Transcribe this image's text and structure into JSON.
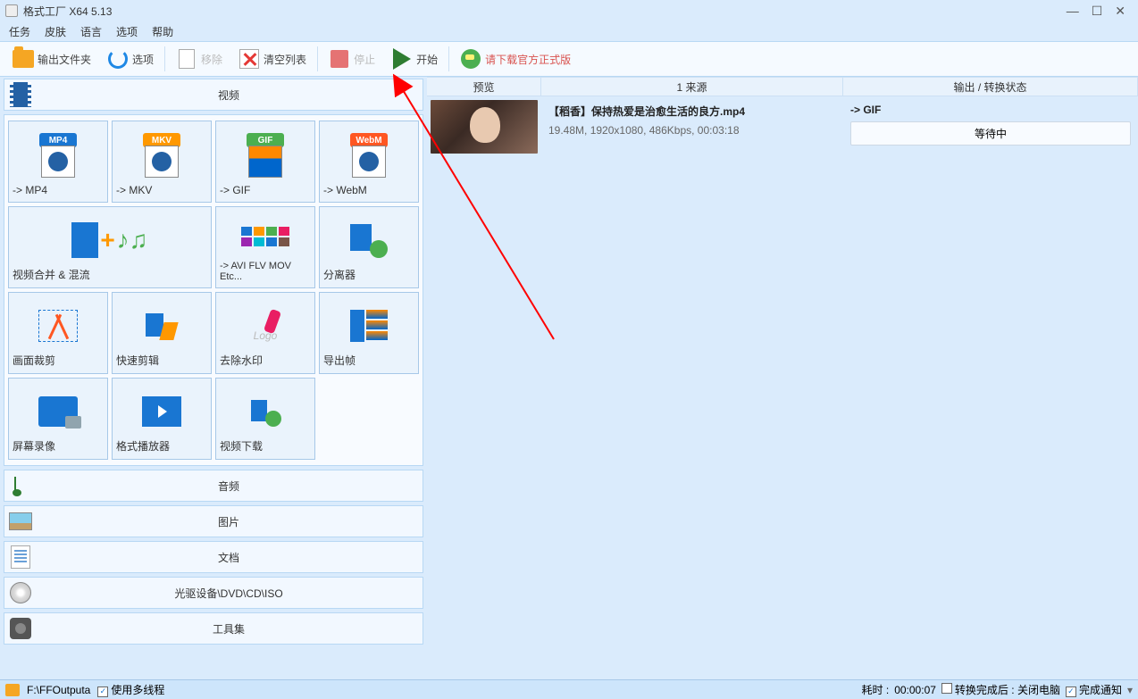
{
  "titlebar": {
    "title": "格式工厂 X64 5.13"
  },
  "menu": {
    "task": "任务",
    "skin": "皮肤",
    "language": "语言",
    "options": "选项",
    "help": "帮助"
  },
  "toolbar": {
    "output_folder": "输出文件夹",
    "options": "选项",
    "remove": "移除",
    "clear_list": "清空列表",
    "stop": "停止",
    "start": "开始",
    "download_official": "请下载官方正式版"
  },
  "categories": {
    "video": "视频",
    "audio": "音频",
    "image": "图片",
    "document": "文档",
    "disc": "光驱设备\\DVD\\CD\\ISO",
    "toolkit": "工具集"
  },
  "video_formats": {
    "mp4": {
      "badge": "MP4",
      "label": "-> MP4",
      "color": "#1976d2"
    },
    "mkv": {
      "badge": "MKV",
      "label": "-> MKV",
      "color": "#ff9800"
    },
    "gif": {
      "badge": "GIF",
      "label": "-> GIF",
      "color": "#4caf50"
    },
    "webm": {
      "badge": "WebM",
      "label": "-> WebM",
      "color": "#ff5722"
    },
    "merge": {
      "label": "视频合并 & 混流"
    },
    "avi_etc": {
      "label": "-> AVI FLV MOV Etc..."
    },
    "splitter": {
      "label": "分离器"
    },
    "crop": {
      "label": "画面裁剪"
    },
    "quick_edit": {
      "label": "快速剪辑"
    },
    "remove_logo": {
      "label": "去除水印",
      "logo_text": "Logo"
    },
    "export_frame": {
      "label": "导出帧"
    },
    "screen_rec": {
      "label": "屏幕录像"
    },
    "player": {
      "label": "格式播放器"
    },
    "video_dl": {
      "label": "视频下载"
    }
  },
  "table": {
    "header_preview": "预览",
    "header_source": "1 来源",
    "header_output": "输出 / 转换状态"
  },
  "task_row": {
    "title": "【稻香】保持热爱是治愈生活的良方.mp4",
    "meta": "19.48M, 1920x1080, 486Kbps, 00:03:18",
    "target": "-> GIF",
    "status": "等待中"
  },
  "statusbar": {
    "output_path": "F:\\FFOutputa",
    "use_multithread": "使用多线程",
    "elapsed_label": "耗时 : ",
    "elapsed": "00:00:07",
    "after_done_label": "转换完成后 : ",
    "after_done": "关闭电脑",
    "notify": "完成通知"
  }
}
